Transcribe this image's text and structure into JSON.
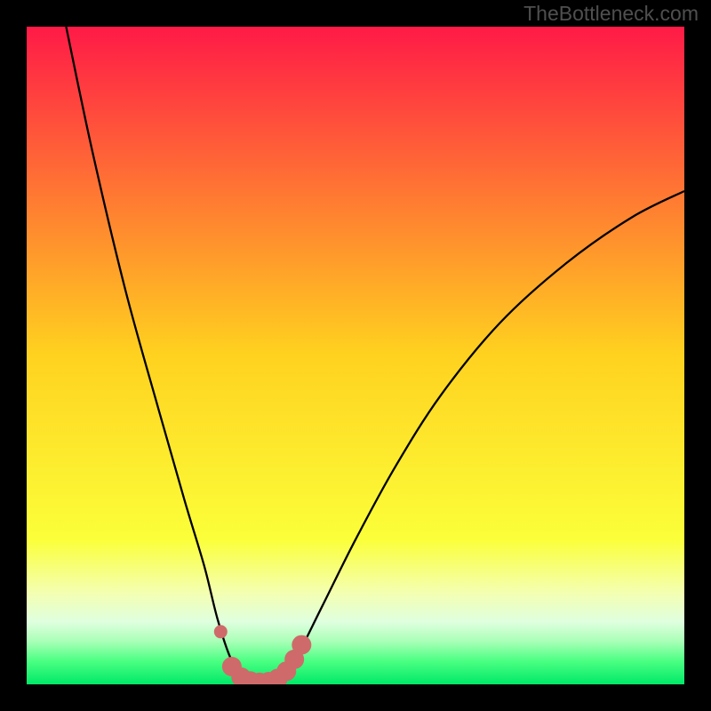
{
  "watermark": "TheBottleneck.com",
  "chart_data": {
    "type": "line",
    "title": "",
    "xlabel": "",
    "ylabel": "",
    "xlim": [
      0,
      100
    ],
    "ylim": [
      0,
      100
    ],
    "gradient_stops": [
      {
        "offset": 0.0,
        "color": "#ff1a47"
      },
      {
        "offset": 0.5,
        "color": "#ffd21f"
      },
      {
        "offset": 0.78,
        "color": "#fbff3a"
      },
      {
        "offset": 0.86,
        "color": "#f4ffb0"
      },
      {
        "offset": 0.905,
        "color": "#dfffdf"
      },
      {
        "offset": 0.935,
        "color": "#a8ffb6"
      },
      {
        "offset": 0.965,
        "color": "#4aff82"
      },
      {
        "offset": 1.0,
        "color": "#00e968"
      }
    ],
    "series": [
      {
        "name": "bottleneck-curve",
        "color": "#000000",
        "points": [
          {
            "x": 6.0,
            "y": 100.0
          },
          {
            "x": 10.0,
            "y": 81.0
          },
          {
            "x": 15.0,
            "y": 60.0
          },
          {
            "x": 20.0,
            "y": 42.0
          },
          {
            "x": 24.0,
            "y": 28.0
          },
          {
            "x": 27.0,
            "y": 18.0
          },
          {
            "x": 29.0,
            "y": 10.0
          },
          {
            "x": 31.0,
            "y": 4.0
          },
          {
            "x": 33.0,
            "y": 1.0
          },
          {
            "x": 35.0,
            "y": 0.3
          },
          {
            "x": 37.0,
            "y": 0.3
          },
          {
            "x": 39.0,
            "y": 1.0
          },
          {
            "x": 41.0,
            "y": 4.0
          },
          {
            "x": 45.0,
            "y": 12.0
          },
          {
            "x": 50.0,
            "y": 22.0
          },
          {
            "x": 56.0,
            "y": 33.0
          },
          {
            "x": 63.0,
            "y": 44.0
          },
          {
            "x": 72.0,
            "y": 55.0
          },
          {
            "x": 82.0,
            "y": 64.0
          },
          {
            "x": 92.0,
            "y": 71.0
          },
          {
            "x": 100.0,
            "y": 75.0
          }
        ]
      },
      {
        "name": "highlight-markers",
        "color": "#cf6a6a",
        "points": [
          {
            "x": 29.5,
            "y": 8.0
          },
          {
            "x": 31.2,
            "y": 2.7
          },
          {
            "x": 32.6,
            "y": 1.1
          },
          {
            "x": 34.0,
            "y": 0.5
          },
          {
            "x": 35.4,
            "y": 0.3
          },
          {
            "x": 36.8,
            "y": 0.4
          },
          {
            "x": 38.2,
            "y": 0.9
          },
          {
            "x": 39.5,
            "y": 2.0
          },
          {
            "x": 40.7,
            "y": 3.8
          },
          {
            "x": 41.8,
            "y": 6.0
          }
        ]
      }
    ]
  }
}
